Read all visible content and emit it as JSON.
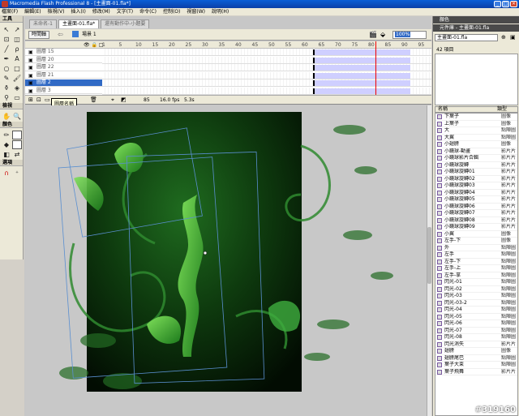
{
  "window": {
    "title": "Macromedia Flash Professional 8 - [主畫面-01.fla*]"
  },
  "menu": [
    "檔案(F)",
    "編輯(E)",
    "檢視(V)",
    "插入(I)",
    "修改(M)",
    "文字(T)",
    "命令(C)",
    "控制(O)",
    "視窗(W)",
    "說明(H)"
  ],
  "toolbox": {
    "title": "工具",
    "view_label": "檢視",
    "color_label": "顏色",
    "options_label": "選項"
  },
  "tabs": [
    "未命名-1",
    "主畫面-01.fla*",
    "還有動作中-小題要"
  ],
  "editbar": {
    "timeline_btn": "時間軸",
    "scene": "場景 1",
    "zoom": "100%"
  },
  "timeline": {
    "layers": [
      "圖層 15",
      "圖層 20",
      "圖層 22",
      "圖層 21",
      "圖層 2",
      "圖層 3"
    ],
    "selected_layer": 4,
    "frame_ticks": [
      "1",
      "5",
      "10",
      "15",
      "20",
      "25",
      "30",
      "35",
      "40",
      "45",
      "50",
      "55",
      "60",
      "65",
      "70",
      "75",
      "80",
      "85",
      "90",
      "95"
    ],
    "current_frame": "85",
    "fps": "16.0 fps",
    "time": "5.3s",
    "tooltip": "圖層名稱"
  },
  "right_panel": {
    "color_panel": "顏色",
    "library_panel": "元件庫 - 主畫面-01.fla",
    "library_doc": "主畫面-01.fla",
    "item_count": "42 項目",
    "col_name": "名稱",
    "col_type": "類型",
    "items": [
      [
        "下葉子",
        "圖像"
      ],
      [
        "上葉子",
        "圖像"
      ],
      [
        "大",
        "點陣圖"
      ],
      [
        "大翼",
        "點陣圖"
      ],
      [
        "小翅膀",
        "圖像"
      ],
      [
        "小鏡球-動畫",
        "影片片"
      ],
      [
        "小鏡球影片合輯",
        "影片片"
      ],
      [
        "小鏡球旋轉",
        "影片片"
      ],
      [
        "小鏡球旋轉01",
        "影片片"
      ],
      [
        "小鏡球旋轉02",
        "影片片"
      ],
      [
        "小鏡球旋轉03",
        "影片片"
      ],
      [
        "小鏡球旋轉04",
        "影片片"
      ],
      [
        "小鏡球旋轉05",
        "影片片"
      ],
      [
        "小鏡球旋轉06",
        "影片片"
      ],
      [
        "小鏡球旋轉07",
        "影片片"
      ],
      [
        "小鏡球旋轉08",
        "影片片"
      ],
      [
        "小鏡球旋轉09",
        "影片片"
      ],
      [
        "小翼",
        "圖像"
      ],
      [
        "左手-下",
        "圖像"
      ],
      [
        "外",
        "點陣圖"
      ],
      [
        "左手",
        "點陣圖"
      ],
      [
        "左手-下",
        "點陣圖"
      ],
      [
        "左手-上",
        "點陣圖"
      ],
      [
        "左手-拿",
        "點陣圖"
      ],
      [
        "閃光-01",
        "點陣圖"
      ],
      [
        "閃光-02",
        "點陣圖"
      ],
      [
        "閃光-03",
        "點陣圖"
      ],
      [
        "閃光-03-2",
        "點陣圖"
      ],
      [
        "閃光-04",
        "點陣圖"
      ],
      [
        "閃光-05",
        "點陣圖"
      ],
      [
        "閃光-06",
        "點陣圖"
      ],
      [
        "閃光-07",
        "點陣圖"
      ],
      [
        "閃光-08",
        "點陣圖"
      ],
      [
        "閃光消失",
        "影片片"
      ],
      [
        "翅膀",
        "圖像"
      ],
      [
        "翅膀尾巴",
        "點陣圖"
      ],
      [
        "葉子大束",
        "點陣圖"
      ],
      [
        "葉子飛舞",
        "影片片"
      ]
    ]
  },
  "watermark": "#319160",
  "colors": {
    "title_blue": "#0a5fd7",
    "stage_green_dark": "#0b2a0b",
    "stage_green_light": "#2fa52f",
    "selection": "#316ac5"
  }
}
